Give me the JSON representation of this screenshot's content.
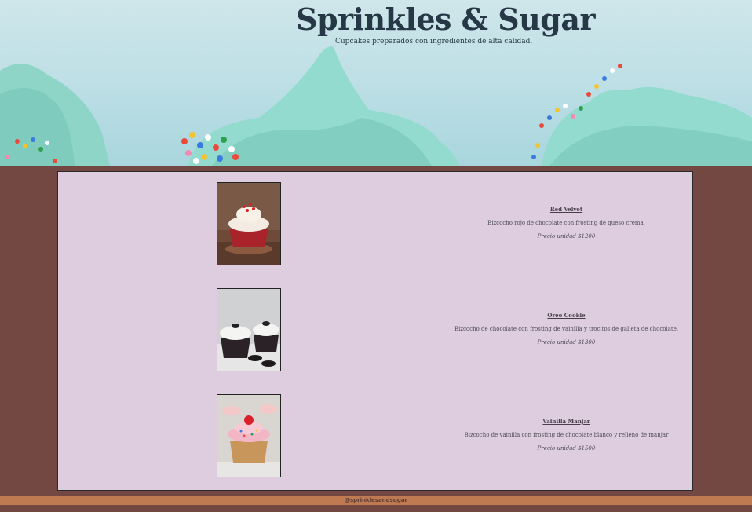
{
  "header": {
    "title": "Sprinkles & Sugar",
    "subtitle": "Cupcakes preparados con ingredientes de alta calidad."
  },
  "products": [
    {
      "name": "Red Velvet",
      "description": "Bizcocho rojo de chocolate con frosting de queso crema.",
      "price": "Precio unidad $1200",
      "image": "red-velvet-cupcake"
    },
    {
      "name": "Oreo Cookie",
      "description": "Bizcocho de chocolate con frosting de vainilla y trocitos de galleta de chocolate.",
      "price": "Precio unidad $1300",
      "image": "oreo-cupcake"
    },
    {
      "name": "Vainilla Manjar",
      "description": "Bizcocho de vainilla con frosting de chocolate blanco y relleno de manjar",
      "price": "Precio unidad $1500",
      "image": "vanilla-cupcake"
    }
  ],
  "footer": {
    "handle": "@sprinklesandsugar"
  },
  "colors": {
    "background": "#734843",
    "panel": "#ddcddf",
    "footer": "#c07a52",
    "title": "#263846"
  }
}
